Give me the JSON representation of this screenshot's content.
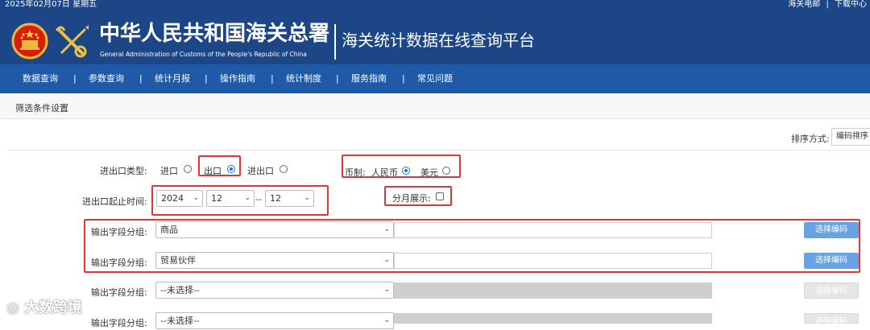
{
  "topbar": {
    "date": "2025年02月07日 星期五",
    "links": [
      "海关电邮",
      "|",
      "下载中心"
    ]
  },
  "brand": {
    "name_cn": "中华人民共和国海关总署",
    "name_en": "General Administration of Customs of the People's Republic of China",
    "platform_title": "海关统计数据在线查询平台"
  },
  "nav": {
    "items": [
      "数据查询",
      "参数查询",
      "统计月报",
      "操作指南",
      "统计制度",
      "服务指南",
      "常见问题"
    ],
    "separator": "|"
  },
  "filter": {
    "section_title": "筛选条件设置",
    "sort": {
      "label": "排序方式:",
      "value": "编码排序"
    },
    "trade_type": {
      "label": "进出口类型:",
      "options": [
        "进口",
        "出口",
        "进出口"
      ],
      "selected": "出口"
    },
    "currency": {
      "label": "币制:",
      "options": [
        "人民币",
        "美元"
      ],
      "selected": "人民币"
    },
    "period": {
      "label": "进出口起止时间:",
      "year": "2024",
      "start_month": "12",
      "separator": "--",
      "end_month": "12"
    },
    "monthly": {
      "label": "分月展示:",
      "checked": false
    },
    "output_groups": [
      {
        "label": "输出字段分组:",
        "value": "商品",
        "button": "选择编码",
        "enabled": true
      },
      {
        "label": "输出字段分组:",
        "value": "贸易伙伴",
        "button": "选择编码",
        "enabled": true
      },
      {
        "label": "输出字段分组:",
        "value": "--未选择--",
        "button": "选择编码",
        "enabled": false
      },
      {
        "label": "输出字段分组:",
        "value": "--未选择--",
        "button": "选择编码",
        "enabled": false
      }
    ]
  },
  "watermark": "大数跨境",
  "colors": {
    "header": "#1d4687",
    "nav": "#1f5aa8",
    "highlight": "#e0353a",
    "button": "#66a3e3"
  }
}
